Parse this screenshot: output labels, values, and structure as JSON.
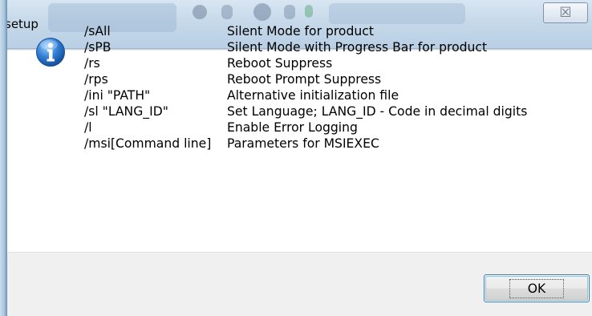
{
  "window": {
    "title": "setup",
    "close_glyph": "☒"
  },
  "dialog": {
    "icon": "info-icon",
    "options": [
      {
        "switch": "/sAll",
        "description": "Silent Mode for product"
      },
      {
        "switch": "/sPB",
        "description": "Silent Mode with Progress Bar for product"
      },
      {
        "switch": "/rs",
        "description": "Reboot Suppress"
      },
      {
        "switch": "/rps",
        "description": "Reboot Prompt Suppress"
      },
      {
        "switch": "/ini \"PATH\"",
        "description": "Alternative initialization file"
      },
      {
        "switch": "/sl \"LANG_ID\"",
        "description": "Set Language; LANG_ID - Code in decimal digits"
      },
      {
        "switch": "/l",
        "description": "Enable Error Logging"
      },
      {
        "switch": "/msi[Command line]",
        "description": "Parameters for MSIEXEC"
      }
    ]
  },
  "buttons": {
    "ok_label": "OK"
  },
  "colors": {
    "titlebar": "#c6d9ea",
    "client": "#ffffff",
    "button_bar": "#f0f0f0",
    "focus_border": "#3c7fb1",
    "info_icon": "#1f63b8"
  }
}
